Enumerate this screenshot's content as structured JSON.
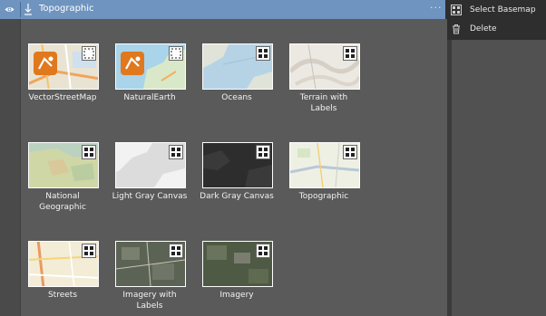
{
  "header": {
    "title": "Topographic",
    "more": "···"
  },
  "menu": {
    "items": [
      {
        "label": "Select Basemap"
      },
      {
        "label": "Delete"
      }
    ]
  },
  "basemaps": [
    {
      "label": "VectorStreetMap"
    },
    {
      "label": "NaturalEarth"
    },
    {
      "label": "Oceans"
    },
    {
      "label": "Terrain with\nLabels"
    },
    {
      "label": "National\nGeographic"
    },
    {
      "label": "Light Gray Canvas"
    },
    {
      "label": "Dark Gray Canvas"
    },
    {
      "label": "Topographic"
    },
    {
      "label": "Streets"
    },
    {
      "label": "Imagery with\nLabels"
    },
    {
      "label": "Imagery"
    }
  ],
  "colors": {
    "header": "#6f94bf",
    "panel": "#5a5a5a",
    "menu": "#2e2e2e",
    "vector_badge": "#e0781e"
  }
}
